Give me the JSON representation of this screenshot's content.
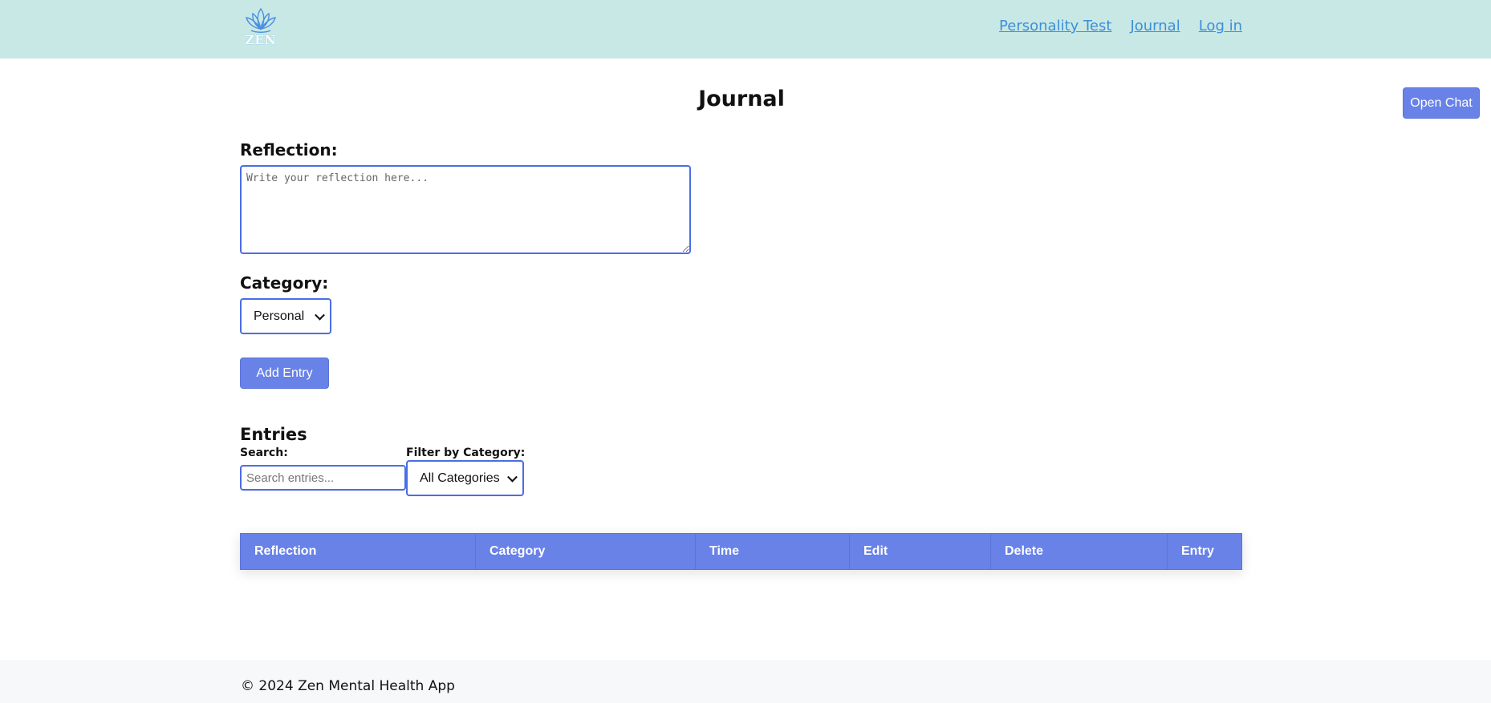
{
  "header": {
    "logo_text": "ZEN",
    "nav": [
      "Personality Test",
      "Journal",
      "Log in"
    ]
  },
  "page_title": "Journal",
  "open_chat_label": "Open Chat",
  "form": {
    "reflection_label": "Reflection:",
    "reflection_placeholder": "Write your reflection here...",
    "category_label": "Category:",
    "category_selected": "Personal",
    "add_entry_label": "Add Entry"
  },
  "entries": {
    "heading": "Entries",
    "search_label": "Search:",
    "search_placeholder": "Search entries...",
    "filter_label": "Filter by Category:",
    "filter_selected": "All Categories",
    "columns": [
      "Reflection",
      "Category",
      "Time",
      "Edit",
      "Delete",
      "Entry"
    ]
  },
  "footer": {
    "text": "© 2024 Zen Mental Health App"
  },
  "colors": {
    "header_bg": "#c8e8e6",
    "accent": "#6882e8",
    "link": "#3d8fd8",
    "input_border": "#4a6de6"
  }
}
